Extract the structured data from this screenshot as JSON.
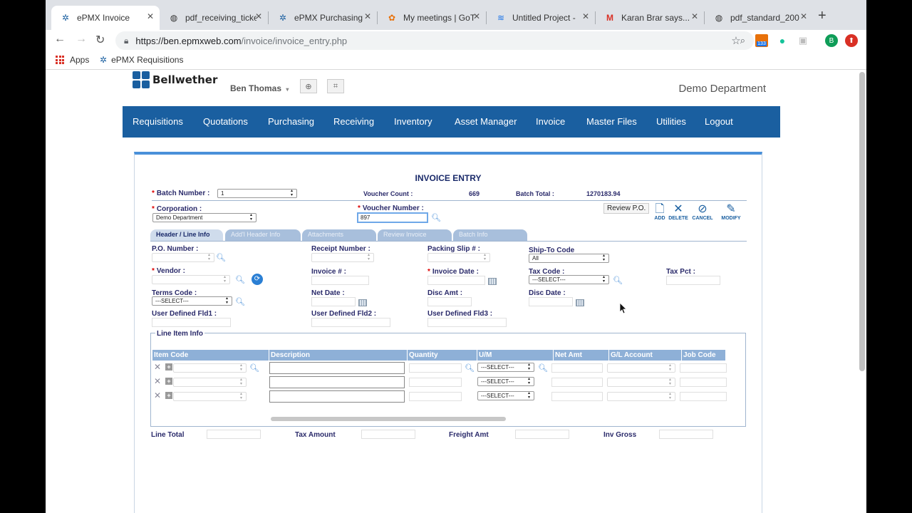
{
  "browser": {
    "tabs": [
      {
        "title": "ePMX Invoice",
        "icon": "epmx-icon",
        "active": true
      },
      {
        "title": "pdf_receiving_ticke",
        "icon": "globe-icon"
      },
      {
        "title": "ePMX Purchasing",
        "icon": "epmx-icon"
      },
      {
        "title": "My meetings | GoT",
        "icon": "gotomeeting-icon"
      },
      {
        "title": "Untitled Project -",
        "icon": "project-icon"
      },
      {
        "title": "Karan Brar says...",
        "icon": "gmail-icon"
      },
      {
        "title": "pdf_standard_200",
        "icon": "globe-icon"
      }
    ],
    "url_host": "https://ben.epmxweb.com",
    "url_path": "/invoice/invoice_entry.php",
    "extension_badge": "133",
    "profile_initial": "B",
    "bookmarks": [
      "Apps",
      "ePMX Requisitions"
    ]
  },
  "header": {
    "brand": "Bellwether",
    "user": "Ben Thomas",
    "department": "Demo Department"
  },
  "nav": [
    "Requisitions",
    "Quotations",
    "Purchasing",
    "Receiving",
    "Inventory",
    "Asset Manager",
    "Invoice",
    "Master Files",
    "Utilities",
    "Logout"
  ],
  "form": {
    "title": "INVOICE ENTRY",
    "batch_number_label": "Batch Number :",
    "batch_number_value": "1",
    "voucher_count_label": "Voucher Count :",
    "voucher_count_value": "669",
    "batch_total_label": "Batch Total :",
    "batch_total_value": "1270183.94",
    "corporation_label": "Corporation :",
    "corporation_value": "Demo Department",
    "voucher_number_label": "Voucher Number :",
    "voucher_number_value": "897",
    "review_po": "Review P.O.",
    "actions": {
      "add": "ADD",
      "delete": "DELETE",
      "cancel": "CANCEL",
      "modify": "MODIFY"
    },
    "tabs": [
      "Header / Line Info",
      "Add'l Header Info",
      "Attachments",
      "Review Invoice",
      "Batch Info"
    ],
    "po_number": "P.O. Number :",
    "receipt_number": "Receipt Number :",
    "packing_slip": "Packing Slip # :",
    "ship_to_code": "Ship-To Code",
    "ship_to_value": "All",
    "vendor": "Vendor :",
    "invoice_number": "Invoice # :",
    "invoice_date": "Invoice Date :",
    "tax_code": "Tax Code :",
    "tax_code_value": "---SELECT---",
    "tax_pct": "Tax Pct :",
    "terms_code": "Terms Code :",
    "terms_code_value": "---SELECT---",
    "net_date": "Net Date :",
    "disc_amt": "Disc Amt :",
    "disc_date": "Disc Date :",
    "udf1": "User Defined Fld1 :",
    "udf2": "User Defined Fld2 :",
    "udf3": "User Defined Fld3 :",
    "line_item_info": "Line Item Info",
    "columns": [
      "Item Code",
      "Description",
      "Quantity",
      "U/M",
      "Net Amt",
      "G/L Account",
      "Job Code"
    ],
    "um_value": "---SELECT---",
    "line_total": "Line Total",
    "tax_amount": "Tax Amount",
    "freight_amt": "Freight Amt",
    "inv_gross": "Inv Gross"
  }
}
